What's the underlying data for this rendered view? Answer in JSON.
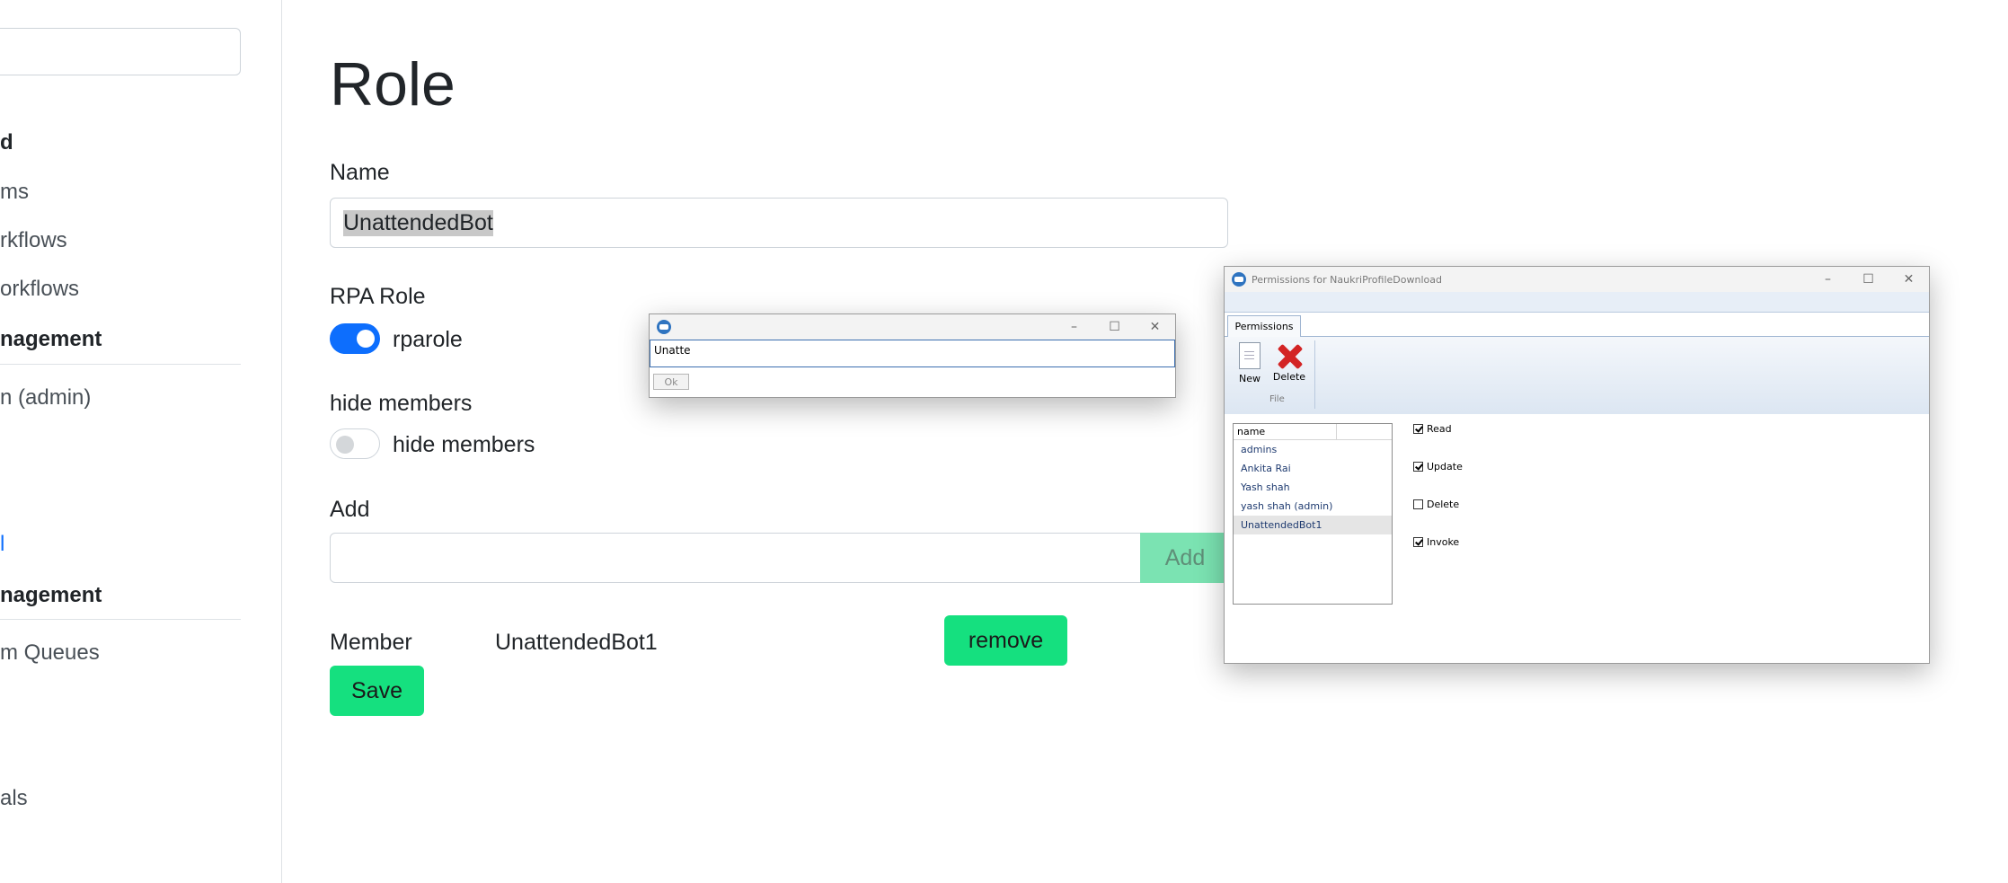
{
  "sidebar": {
    "items": [
      {
        "label": "d",
        "kind": "head"
      },
      {
        "label": "ms",
        "kind": "normal"
      },
      {
        "label": "rkflows",
        "kind": "normal"
      },
      {
        "label": "orkflows",
        "kind": "normal"
      },
      {
        "label": "nagement",
        "kind": "head"
      },
      {
        "label": "n (admin)",
        "kind": "normal"
      },
      {
        "label": "l",
        "kind": "link"
      },
      {
        "label": "nagement",
        "kind": "head"
      },
      {
        "label": "m Queues",
        "kind": "normal"
      },
      {
        "label": "als",
        "kind": "normal"
      }
    ]
  },
  "form": {
    "title": "Role",
    "name_label": "Name",
    "name_value": "UnattendedBot",
    "rpa_role_label": "RPA Role",
    "rpa_toggle_label": "rparole",
    "rpa_toggle_on": true,
    "hide_members_label": "hide members",
    "hide_toggle_label": "hide members",
    "hide_toggle_on": false,
    "add_label": "Add",
    "add_value": "",
    "add_button": "Add",
    "member_label": "Member",
    "member_name": "UnattendedBot1",
    "remove_button": "remove",
    "save_button": "Save"
  },
  "input_dialog": {
    "title": "",
    "value": "Unatte",
    "ok_button": "Ok"
  },
  "perm_dialog": {
    "title": "Permissions for NaukriProfileDownload",
    "tab": "Permissions",
    "new_button": "New",
    "delete_button": "Delete",
    "group_label": "File",
    "list_header": "name",
    "users": [
      "admins",
      "Ankita Rai",
      "Yash shah",
      "yash shah (admin)",
      "UnattendedBot1"
    ],
    "selected_user": "UnattendedBot1",
    "permissions": [
      {
        "label": "Read",
        "checked": true
      },
      {
        "label": "Update",
        "checked": true
      },
      {
        "label": "Delete",
        "checked": false
      },
      {
        "label": "Invoke",
        "checked": true
      }
    ]
  },
  "window_controls": {
    "minimize": "–",
    "maximize": "☐",
    "close": "✕"
  },
  "colors": {
    "accent": "#0d6efd",
    "green": "#15e07f"
  }
}
